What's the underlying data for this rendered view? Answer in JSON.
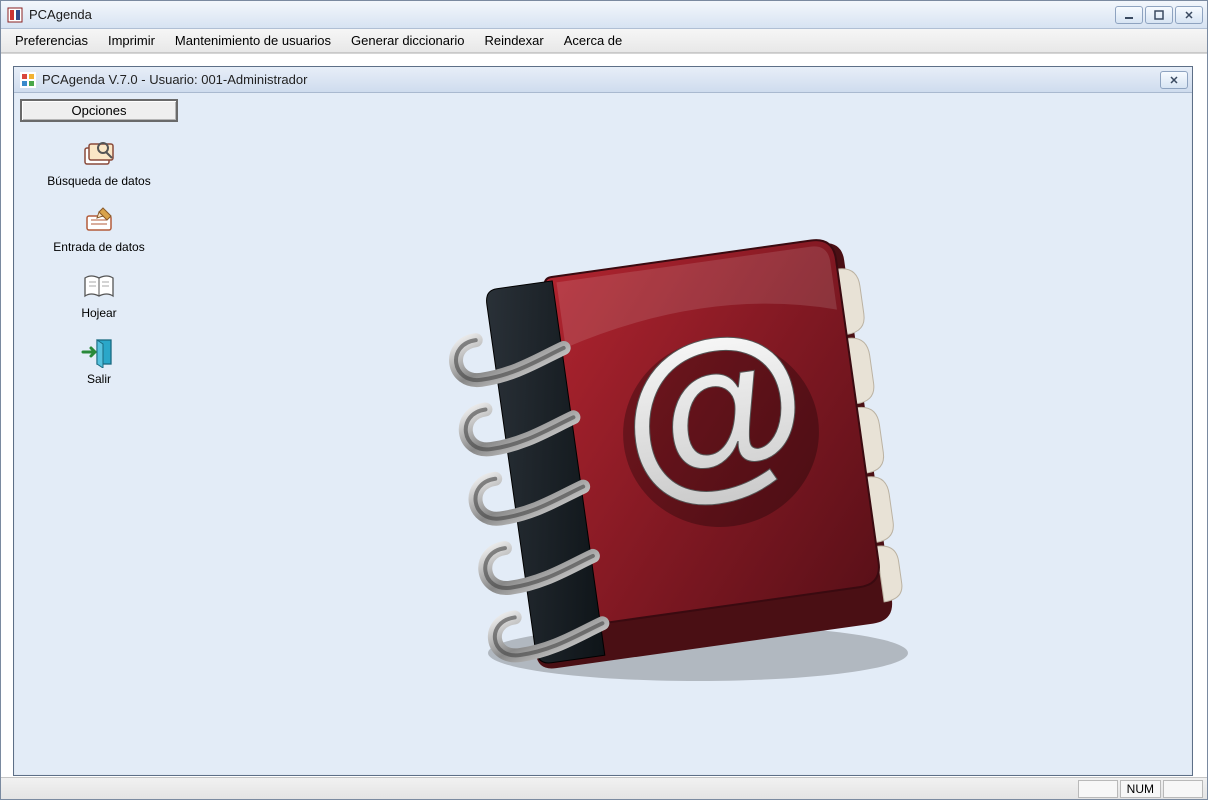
{
  "window": {
    "title": "PCAgenda"
  },
  "menu": {
    "items": [
      "Preferencias",
      "Imprimir",
      "Mantenimiento de usuarios",
      "Generar diccionario",
      "Reindexar",
      "Acerca de"
    ]
  },
  "inner_window": {
    "title": "PCAgenda  V.7.0 - Usuario: 001-Administrador"
  },
  "sidebar": {
    "header": "Opciones",
    "items": [
      {
        "label": "Búsqueda de datos"
      },
      {
        "label": "Entrada de datos"
      },
      {
        "label": "Hojear"
      },
      {
        "label": "Salir"
      }
    ]
  },
  "statusbar": {
    "num": "NUM"
  }
}
